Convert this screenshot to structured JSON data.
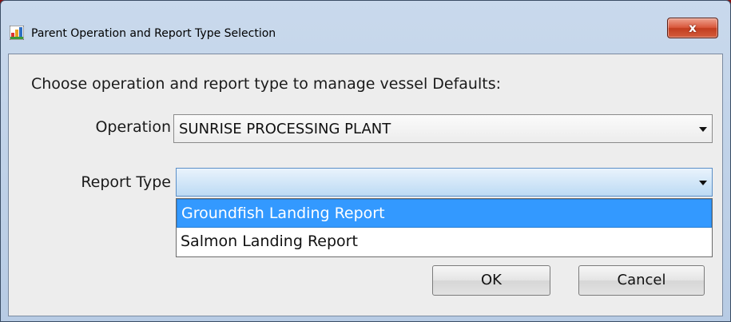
{
  "window": {
    "title": "Parent Operation and Report Type Selection",
    "app_icon": "app-icon",
    "close_icon": "close-x-icon",
    "close_glyph": "x"
  },
  "dialog": {
    "prompt": "Choose operation and report type to manage vessel Defaults:",
    "operation": {
      "label": "Operation",
      "selected": "SUNRISE PROCESSING PLANT"
    },
    "report_type": {
      "label": "Report Type",
      "selected": "",
      "options": [
        {
          "label": "Groundfish Landing Report",
          "highlighted": true
        },
        {
          "label": "Salmon Landing Report",
          "highlighted": false
        }
      ]
    },
    "buttons": {
      "ok": "OK",
      "cancel": "Cancel"
    }
  },
  "colors": {
    "highlight": "#3399ff",
    "close_button": "#d9573b",
    "desktop": "#8a0f0f"
  }
}
